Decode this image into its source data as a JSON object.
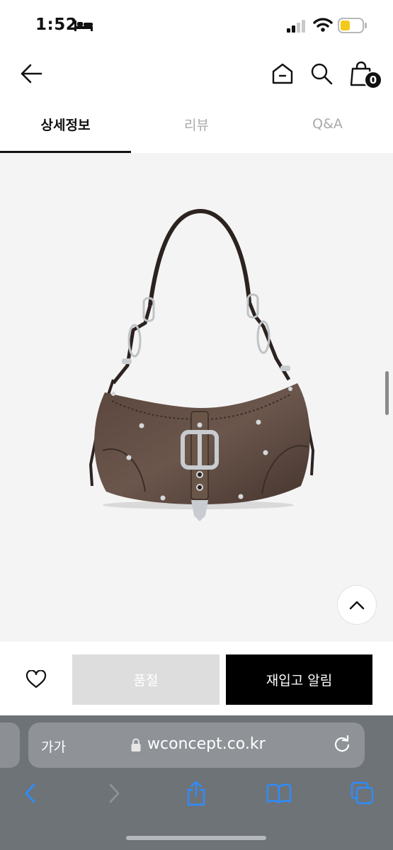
{
  "status_bar": {
    "time": "1:52",
    "colors": {
      "battery_fill": "#f4c91a"
    }
  },
  "header": {
    "cart_count": "0"
  },
  "tabs": [
    {
      "label": "상세정보",
      "active": true
    },
    {
      "label": "리뷰",
      "active": false
    },
    {
      "label": "Q&A",
      "active": false
    }
  ],
  "product": {
    "image_description_icon": "bag-image"
  },
  "actions": {
    "soldout_label": "품절",
    "restock_label": "재입고 알림",
    "colors": {
      "soldout_bg": "#dddddd",
      "restock_bg": "#000000"
    }
  },
  "browser": {
    "text_size_label": "가가",
    "url": "wconcept.co.kr"
  }
}
